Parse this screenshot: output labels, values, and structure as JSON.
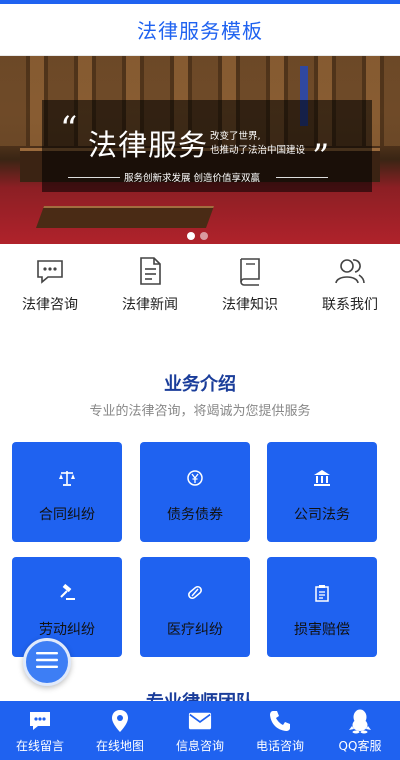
{
  "header": {
    "title": "法律服务模板"
  },
  "banner": {
    "headline": "法律服务",
    "side_line1": "改变了世界,",
    "side_line2": "也推动了法治中国建设",
    "slogan": "服务创新求发展 创造价值享双赢",
    "quote_open": "“",
    "quote_close": "”",
    "slides_total": 2,
    "active_slide": 1
  },
  "quicknav": [
    {
      "label": "法律咨询",
      "icon": "chat-bubble-icon"
    },
    {
      "label": "法律新闻",
      "icon": "document-icon"
    },
    {
      "label": "法律知识",
      "icon": "book-icon"
    },
    {
      "label": "联系我们",
      "icon": "users-icon"
    }
  ],
  "services": {
    "title": "业务介绍",
    "subtitle": "专业的法律咨询，将竭诚为您提供服务",
    "items": [
      {
        "label": "合同纠纷",
        "icon": "scales-icon"
      },
      {
        "label": "债务债券",
        "icon": "currency-icon"
      },
      {
        "label": "公司法务",
        "icon": "building-icon"
      },
      {
        "label": "劳动纠纷",
        "icon": "gavel-icon"
      },
      {
        "label": "医疗纠纷",
        "icon": "pill-icon"
      },
      {
        "label": "损害赔偿",
        "icon": "clipboard-icon"
      }
    ]
  },
  "next_section": {
    "title": "专业律师团队"
  },
  "bottombar": [
    {
      "label": "在线留言",
      "icon": "message-icon"
    },
    {
      "label": "在线地图",
      "icon": "map-pin-icon"
    },
    {
      "label": "信息咨询",
      "icon": "envelope-icon"
    },
    {
      "label": "电话咨询",
      "icon": "phone-icon"
    },
    {
      "label": "QQ客服",
      "icon": "qq-penguin-icon"
    }
  ],
  "colors": {
    "brand": "#1f62f0",
    "title": "#1a3d9a",
    "fab": "#3d7ef5"
  }
}
